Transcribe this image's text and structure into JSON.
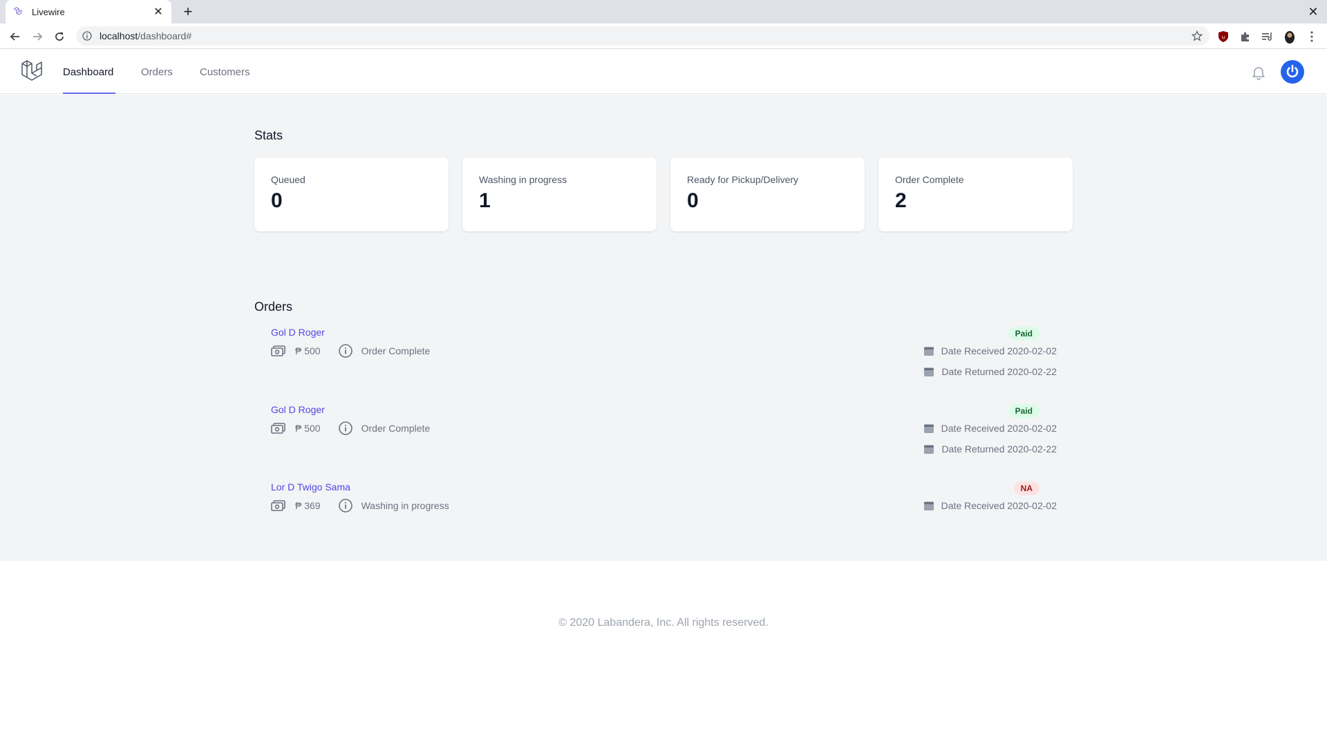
{
  "browser": {
    "tab_title": "Livewire",
    "new_tab_glyph": "+",
    "url_host": "localhost",
    "url_path": "/dashboard#"
  },
  "nav": {
    "links": [
      {
        "label": "Dashboard",
        "active": true
      },
      {
        "label": "Orders",
        "active": false
      },
      {
        "label": "Customers",
        "active": false
      }
    ],
    "accent_color": "#6366f1"
  },
  "stats": {
    "title": "Stats",
    "cards": [
      {
        "label": "Queued",
        "value": "0"
      },
      {
        "label": "Washing in progress",
        "value": "1"
      },
      {
        "label": "Ready for Pickup/Delivery",
        "value": "0"
      },
      {
        "label": "Order Complete",
        "value": "2"
      }
    ]
  },
  "orders": {
    "title": "Orders",
    "items": [
      {
        "customer": "Gol D Roger",
        "amount": "₱ 500",
        "status": "Order Complete",
        "payment_badge": "Paid",
        "date_received": "Date Received 2020-02-02",
        "date_returned": "Date Returned 2020-02-22"
      },
      {
        "customer": "Gol D Roger",
        "amount": "₱ 500",
        "status": "Order Complete",
        "payment_badge": "Paid",
        "date_received": "Date Received 2020-02-02",
        "date_returned": "Date Returned 2020-02-22"
      },
      {
        "customer": "Lor D Twigo Sama",
        "amount": "₱ 369",
        "status": "Washing in progress",
        "payment_badge": "NA",
        "date_received": "Date Received 2020-02-02"
      }
    ]
  },
  "footer": {
    "text": "© 2020 Labandera, Inc. All rights reserved."
  },
  "icons": [
    "laravel-favicon",
    "close-icon",
    "back-arrow-icon",
    "forward-arrow-icon",
    "reload-icon",
    "info-icon",
    "star-icon",
    "ublock-icon",
    "puzzle-icon",
    "media-queue-icon",
    "profile-icon",
    "kebab-menu-icon",
    "laravel-logo",
    "bell-icon",
    "power-icon",
    "cash-icon",
    "calendar-icon"
  ]
}
